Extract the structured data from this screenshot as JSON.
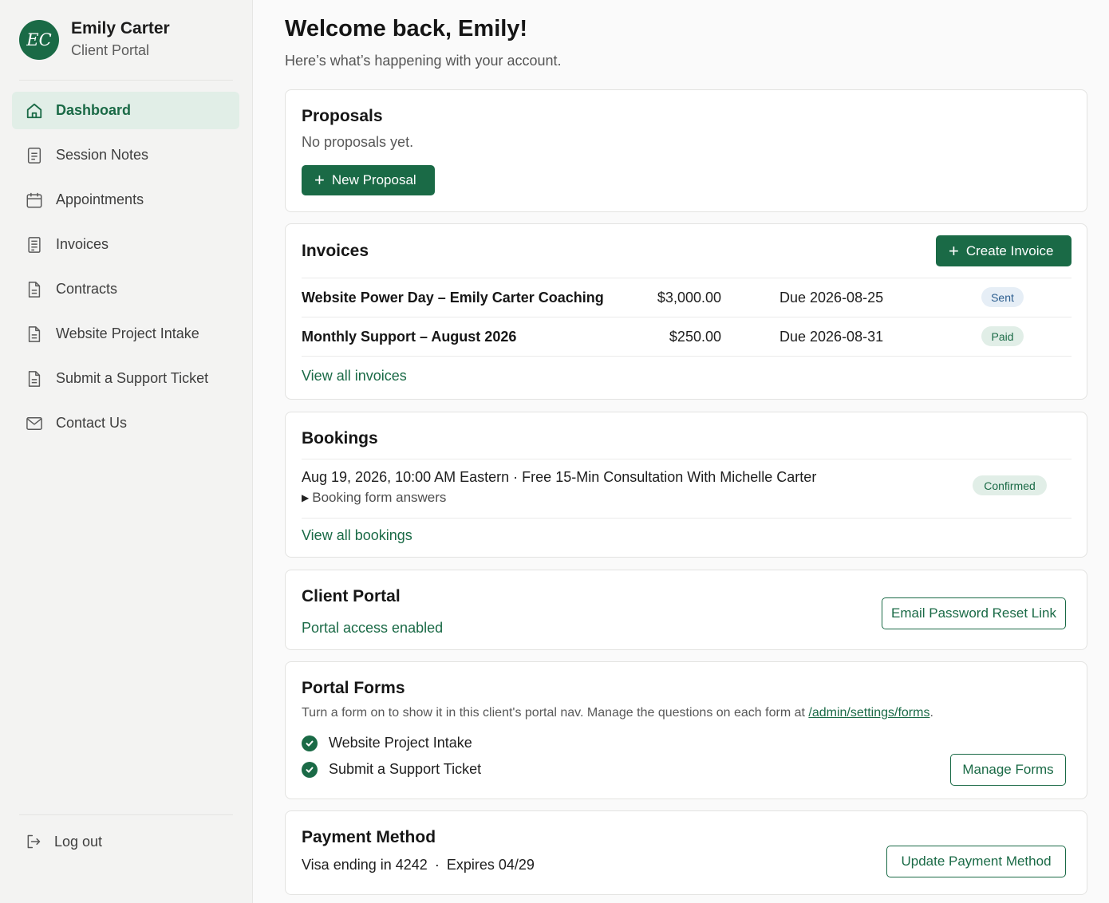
{
  "user": {
    "initials": "EC",
    "name": "Emily Carter",
    "subtitle": "Client Portal"
  },
  "sidebar": {
    "items": [
      {
        "label": "Dashboard",
        "icon": "home-icon",
        "active": true
      },
      {
        "label": "Session Notes",
        "icon": "note-icon"
      },
      {
        "label": "Appointments",
        "icon": "calendar-icon"
      },
      {
        "label": "Invoices",
        "icon": "receipt-icon"
      },
      {
        "label": "Contracts",
        "icon": "document-icon"
      },
      {
        "label": "Website Project Intake",
        "icon": "document-icon"
      },
      {
        "label": "Submit a Support Ticket",
        "icon": "document-icon"
      },
      {
        "label": "Contact Us",
        "icon": "mail-icon"
      }
    ],
    "logout_label": "Log out"
  },
  "header": {
    "title": "Welcome back, Emily!",
    "subtitle": "Here’s what’s happening with your account."
  },
  "proposals": {
    "title": "Proposals",
    "empty_text": "No proposals yet.",
    "new_label": "New Proposal"
  },
  "invoices": {
    "title": "Invoices",
    "create_label": "Create Invoice",
    "rows": [
      {
        "name": "Website Power Day – Emily Carter Coaching",
        "amount": "$3,000.00",
        "due": "Due 2026-08-25",
        "status": "Sent"
      },
      {
        "name": "Monthly Support – August 2026",
        "amount": "$250.00",
        "due": "Due 2026-08-31",
        "status": "Paid"
      }
    ],
    "view_all": "View all invoices"
  },
  "bookings": {
    "title": "Bookings",
    "items": [
      {
        "summary": "Aug 19, 2026, 10:00 AM Eastern · Free 15-Min Consultation With Michelle Carter",
        "details_label": "Booking form answers",
        "status": "Confirmed"
      }
    ],
    "view_all": "View all bookings"
  },
  "client_portal": {
    "title": "Client Portal",
    "status": "Portal access enabled",
    "reset_label": "Email Password Reset Link"
  },
  "portal_forms": {
    "title": "Portal Forms",
    "description": "Turn a form on to show it in this client's portal nav. Manage the questions on each form at ",
    "settings_link": "/admin/settings/forms",
    "description_end": ".",
    "forms": [
      {
        "label": "Website Project Intake",
        "enabled": true
      },
      {
        "label": "Submit a Support Ticket",
        "enabled": true
      }
    ],
    "manage_label": "Manage Forms"
  },
  "payment": {
    "title": "Payment Method",
    "card_text": "Visa ending in 4242",
    "separator": "·",
    "expiry": "Expires 04/29",
    "update_label": "Update Payment Method"
  },
  "colors": {
    "accent": "#1a6a46",
    "active_bg": "#e1eee7",
    "sidebar_bg": "#f3f3f2"
  }
}
